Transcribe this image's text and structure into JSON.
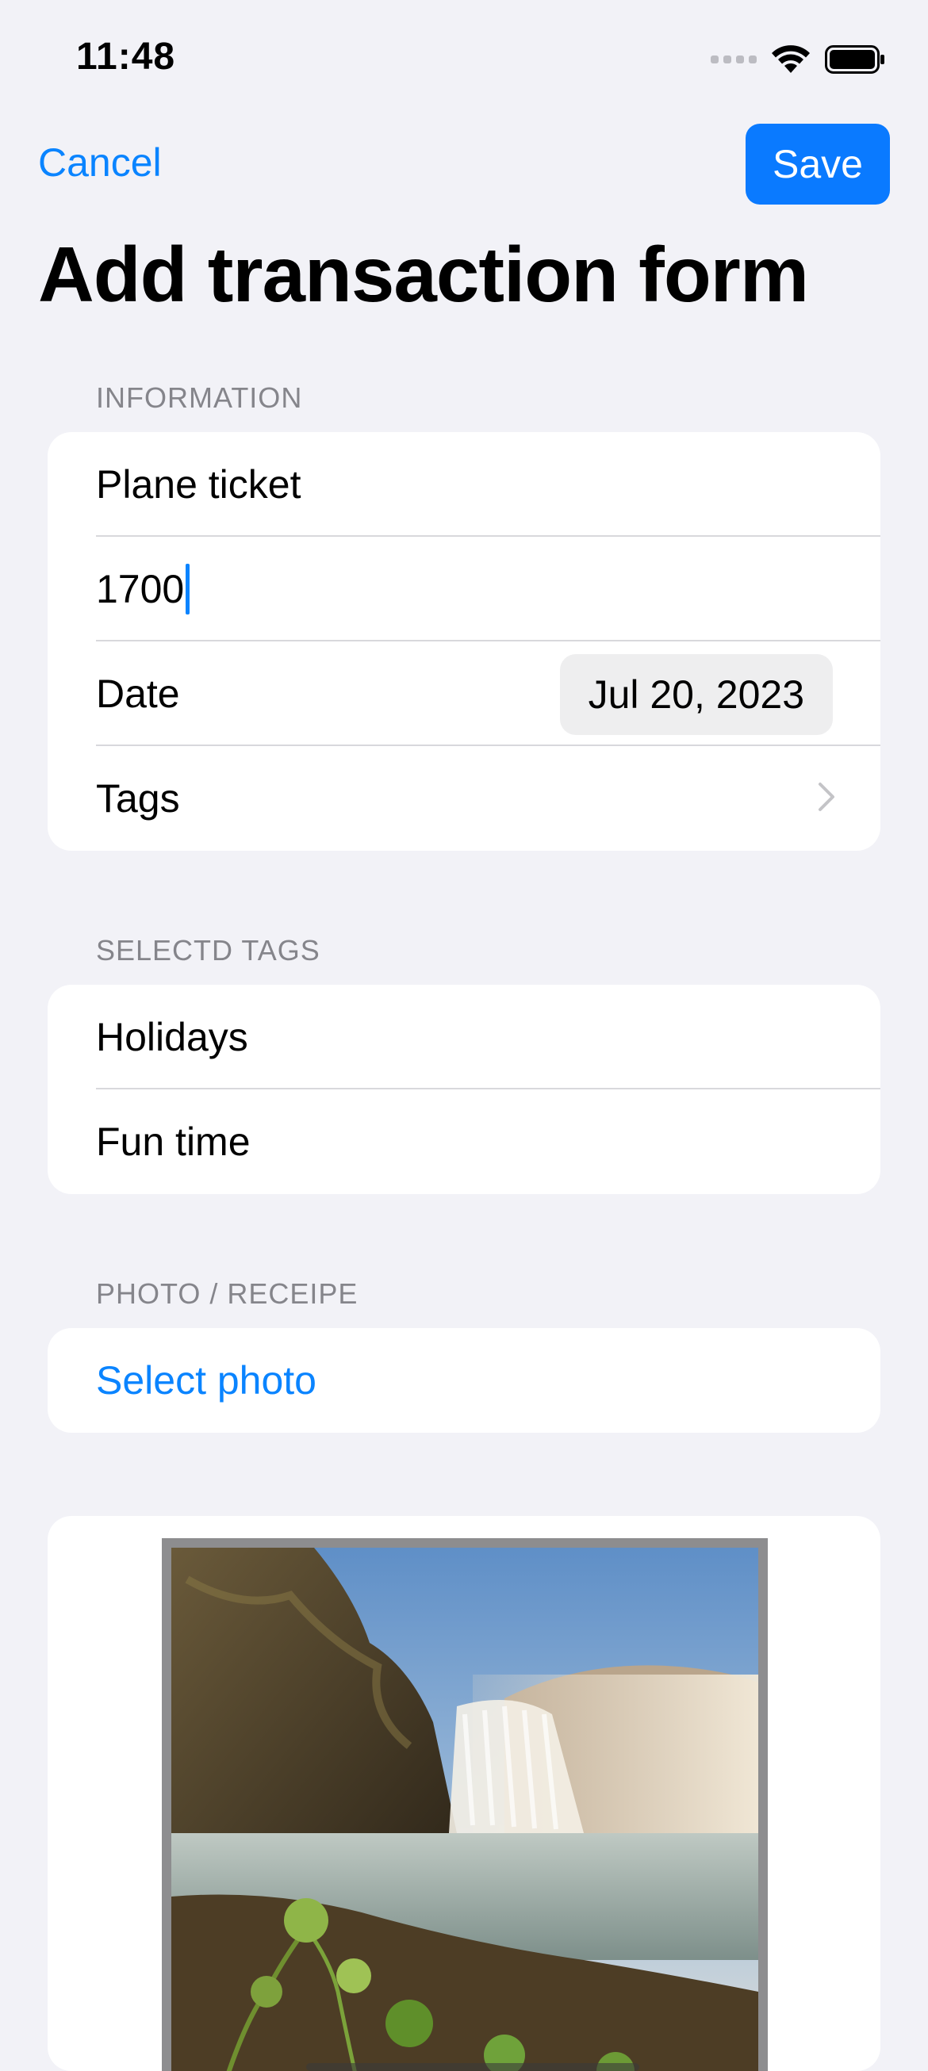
{
  "status_bar": {
    "time": "11:48"
  },
  "nav": {
    "cancel_label": "Cancel",
    "save_label": "Save",
    "title": "Add transaction form"
  },
  "information": {
    "header": "INFORMATION",
    "name_value": "Plane ticket",
    "amount_value": "1700",
    "date_label": "Date",
    "date_value": "Jul 20, 2023",
    "tags_label": "Tags"
  },
  "selected_tags": {
    "header": "SELECTD TAGS",
    "items": [
      "Holidays",
      "Fun time"
    ]
  },
  "photo": {
    "header": "PHOTO / RECEIPE",
    "select_label": "Select photo"
  },
  "colors": {
    "accent": "#0a84ff",
    "background": "#f2f2f7",
    "card": "#ffffff",
    "secondary_text": "#85858b"
  },
  "icons": [
    "signal-icon",
    "wifi-icon",
    "battery-icon",
    "chevron-right-icon"
  ]
}
